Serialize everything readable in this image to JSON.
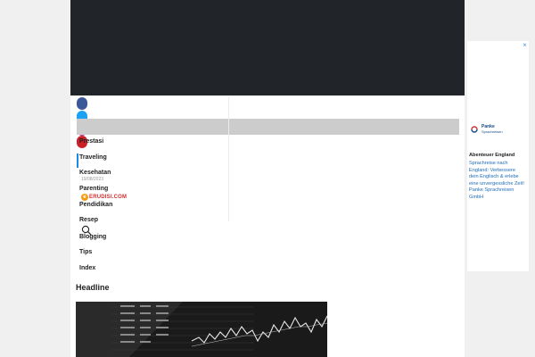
{
  "colors": {
    "header_bg": "#212529",
    "page_bg": "#f0f0f0",
    "active_nav": "#1e88e5",
    "social_facebook": "#3b5998",
    "social_twitter": "#1da1f2",
    "social_instagram": "#c13584",
    "social_pinterest": "#cb2027",
    "logo_red": "#d32f2f"
  },
  "social_icons": [
    "facebook-icon",
    "twitter-icon",
    "instagram-icon",
    "pinterest-icon"
  ],
  "nav": {
    "items": [
      {
        "label": "Prestasi"
      },
      {
        "label": "Traveling",
        "active": true
      },
      {
        "label": "Kesehatan"
      },
      {
        "label": "Parenting"
      },
      {
        "label": "Pendidikan"
      },
      {
        "label": "Resep"
      },
      {
        "label": "Blogging"
      },
      {
        "label": "Tips"
      },
      {
        "label": "Index"
      }
    ]
  },
  "date": "19/08/2023",
  "logo_text": "ERUDISI.COM",
  "main": {
    "headline_heading": "Headline"
  },
  "ad": {
    "brand": "Panke",
    "brand_sub": "Sprachreisen",
    "title": "Abenteuer England",
    "body": "Sprachreise nach England: Verbessere dein Englisch & erlebe eine unvergessliche Zeit! Panke Sprachreisen GmbH"
  }
}
